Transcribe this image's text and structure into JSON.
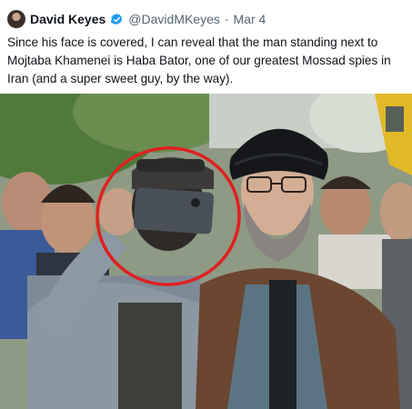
{
  "tweet": {
    "display_name": "David Keyes",
    "handle": "@DavidMKeyes",
    "separator": "·",
    "date": "Mar 4",
    "text": "Since his face is covered, I can reveal that the man standing next to Mojtaba Khamenei is Haba Bator, one of our greatest Mossad spies in Iran (and a super sweet guy, by the way).",
    "verified_color": "#1d9bf0"
  },
  "media": {
    "highlight_color": "#e0201f"
  }
}
